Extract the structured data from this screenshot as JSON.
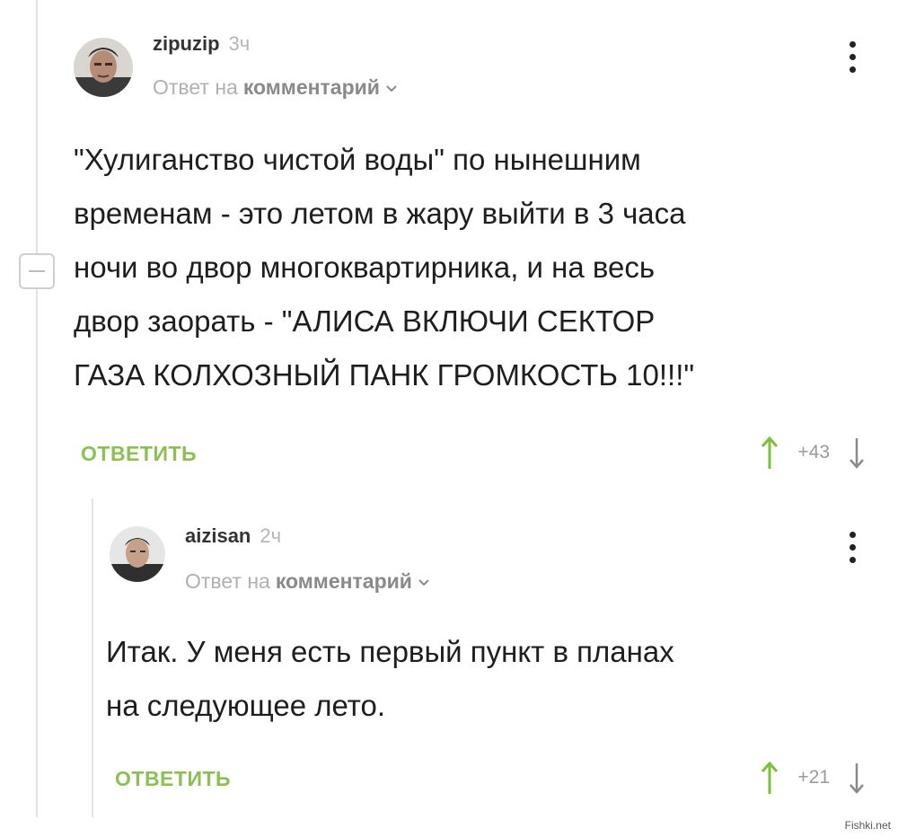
{
  "comments": [
    {
      "author": "zipuzip",
      "time": "3ч",
      "reply_to_prefix": "Ответ на",
      "reply_to_link": "комментарий",
      "text_lines": [
        "\"Хулиганство чистой воды\" по нынешним",
        "временам - это летом в жару выйти в 3 часа",
        "ночи во двор многоквартирника, и на весь",
        "двор заорать - \"АЛИСА ВКЛЮЧИ СЕКТОР",
        "ГАЗА КОЛХОЗНЫЙ ПАНК ГРОМКОСТЬ 10!!!\""
      ],
      "reply_label": "ОТВЕТИТЬ",
      "score": "+43"
    },
    {
      "author": "aizisan",
      "time": "2ч",
      "reply_to_prefix": "Ответ на",
      "reply_to_link": "комментарий",
      "text_lines": [
        "Итак. У меня есть первый пункт в планах",
        "на следующее лето."
      ],
      "reply_label": "ОТВЕТИТЬ",
      "score": "+21"
    }
  ],
  "watermark": "Fishki.net",
  "colors": {
    "accent_green": "#8cbf56",
    "vote_up_green": "#7cbf3a",
    "muted_gray": "#b0b0b0",
    "thread_line": "#e3e3e3"
  },
  "icons": {
    "collapse": "minus-icon",
    "menu": "vertical-dots-icon",
    "vote_up": "arrow-up-icon",
    "vote_down": "arrow-down-icon",
    "reply_chevron": "chevron-down-icon"
  }
}
